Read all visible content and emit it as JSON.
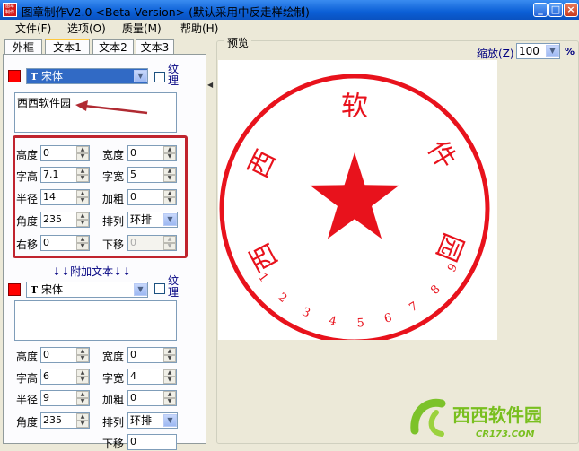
{
  "window": {
    "title": "图章制作V2.0 <Beta Version> (默认采用中反走样绘制)",
    "icon_text": "图章制作"
  },
  "menu": [
    {
      "label": "文件(F)"
    },
    {
      "label": "选项(O)"
    },
    {
      "label": "质量(M)"
    },
    {
      "label": "帮助(H)"
    }
  ],
  "tabs": [
    "外框",
    "文本1",
    "文本2",
    "文本3"
  ],
  "text1": {
    "font": "宋体",
    "texture_label": "纹理",
    "content": "西西软件园",
    "fields": {
      "height": {
        "label": "高度",
        "value": "0"
      },
      "width": {
        "label": "宽度",
        "value": "0"
      },
      "char_height": {
        "label": "字高",
        "value": "7.1"
      },
      "char_width": {
        "label": "字宽",
        "value": "5"
      },
      "radius": {
        "label": "半径",
        "value": "14"
      },
      "bold": {
        "label": "加粗",
        "value": "0"
      },
      "angle": {
        "label": "角度",
        "value": "235"
      },
      "arrange": {
        "label": "排列",
        "value": "环排"
      },
      "right_shift": {
        "label": "右移",
        "value": "0"
      },
      "down_shift": {
        "label": "下移",
        "value": "0"
      }
    }
  },
  "additional": {
    "label": "↓↓附加文本↓↓",
    "font": "宋体",
    "texture_label": "纹理",
    "content": "",
    "fields": {
      "height": {
        "label": "高度",
        "value": "0"
      },
      "width": {
        "label": "宽度",
        "value": "0"
      },
      "char_height": {
        "label": "字高",
        "value": "6"
      },
      "char_width": {
        "label": "字宽",
        "value": "4"
      },
      "radius": {
        "label": "半径",
        "value": "9"
      },
      "bold": {
        "label": "加粗",
        "value": "0"
      },
      "angle": {
        "label": "角度",
        "value": "235"
      },
      "arrange": {
        "label": "排列",
        "value": "环排"
      },
      "down_shift": {
        "label": "下移",
        "value": "0"
      }
    }
  },
  "preview": {
    "label": "预览",
    "zoom_label": "缩放(Z)",
    "zoom_value": "100",
    "zoom_unit": "%",
    "seal_chars": [
      "西",
      "西",
      "软",
      "件",
      "园"
    ],
    "seal_numbers": [
      "1",
      "2",
      "3",
      "4",
      "5",
      "6",
      "7",
      "8",
      "9"
    ],
    "seal_color": "#e8121c"
  },
  "watermark": {
    "brand": "西西软件园",
    "site": "CR173.COM"
  }
}
